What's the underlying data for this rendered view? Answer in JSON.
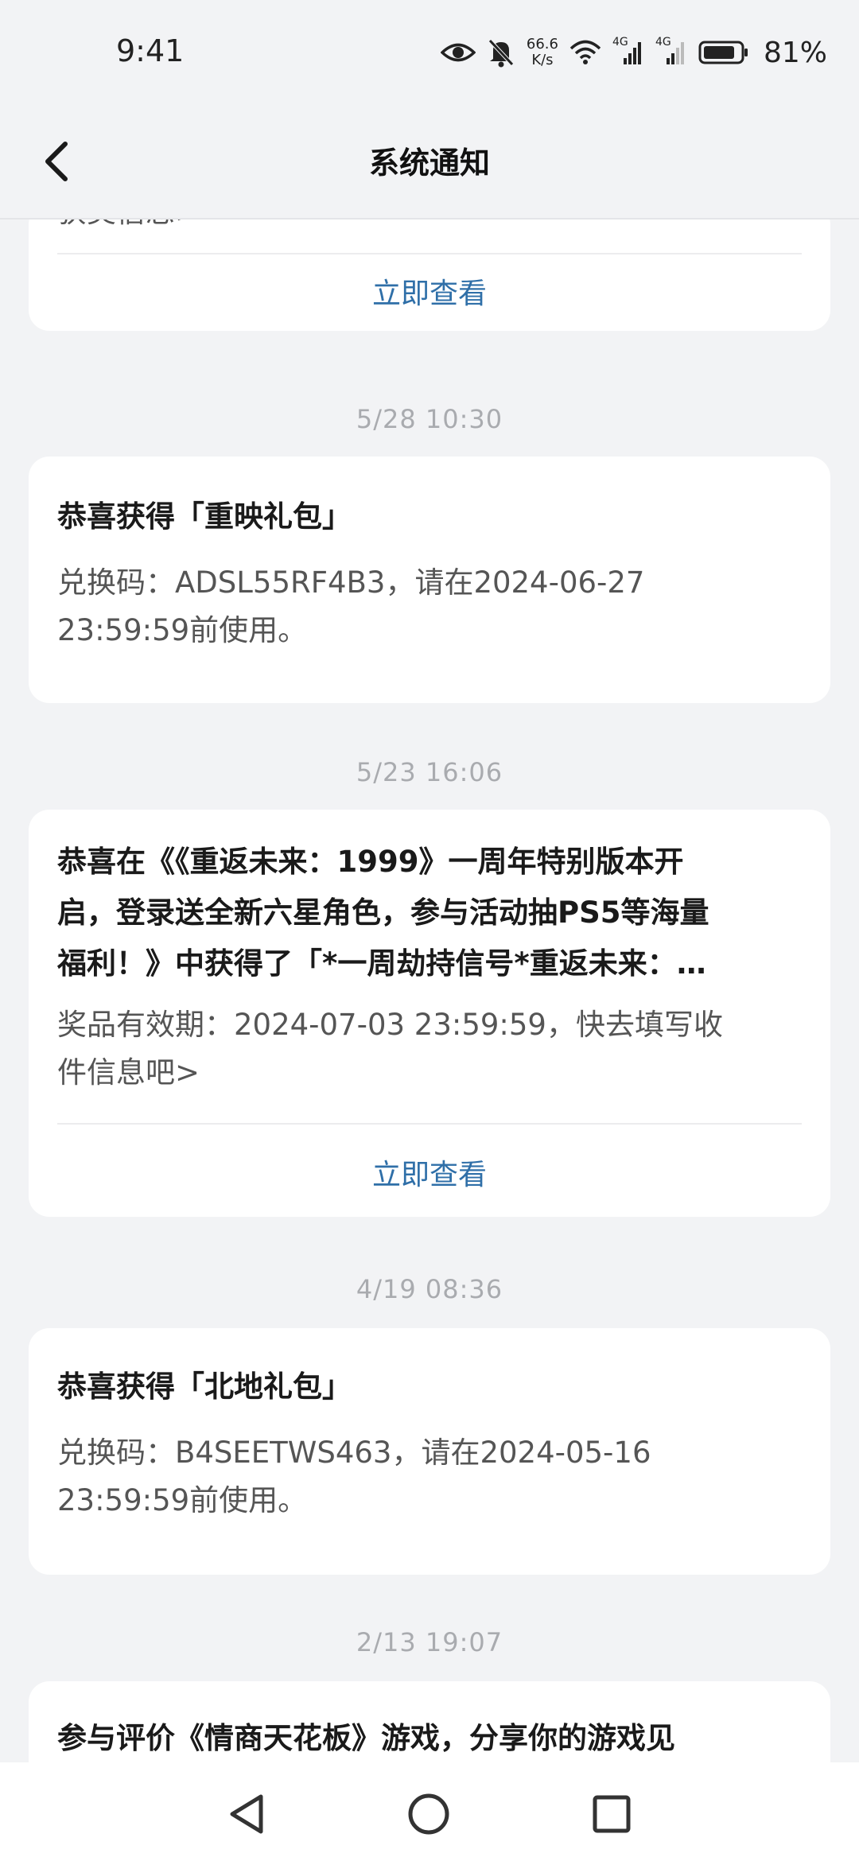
{
  "status_bar": {
    "time": "9:41",
    "net_speed_value": "66.6",
    "net_speed_unit": "K/s",
    "network_1": "4G",
    "network_2": "4G",
    "battery": "81%"
  },
  "header": {
    "title": "系统通知"
  },
  "partial_card": {
    "tail_text": "获奖信息>",
    "action": "立即查看"
  },
  "notifications": [
    {
      "time": "5/28  10:30",
      "title": "恭喜获得「重映礼包」",
      "body_line1": "兑换码：ADSL55RF4B3，请在2024-06-27",
      "body_line2": "23:59:59前使用。"
    },
    {
      "time": "5/23  16:06",
      "title_line1": "恭喜在《《重返未来：1999》一周年特别版本开",
      "title_line2": "启，登录送全新六星角色，参与活动抽PS5等海量",
      "title_line3": "福利！》中获得了「*一周劫持信号*重返未来：…",
      "body_line1": "奖品有效期：2024-07-03 23:59:59，快去填写收",
      "body_line2": "件信息吧>",
      "action": "立即查看"
    },
    {
      "time": "4/19  08:36",
      "title": "恭喜获得「北地礼包」",
      "body_line1": "兑换码：B4SEETWS463，请在2024-05-16",
      "body_line2": "23:59:59前使用。"
    },
    {
      "time": "2/13  19:07",
      "title_line1": "参与评价《情商天花板》游戏，分享你的游戏见"
    }
  ],
  "colors": {
    "background": "#f2f3f5",
    "card": "#ffffff",
    "link": "#2f6fa8",
    "timestamp": "#a9abaf"
  },
  "icons": {
    "back": "chevron-left-icon",
    "eye": "eye-icon",
    "mute": "bell-off-icon",
    "wifi": "wifi-icon",
    "signal": "signal-icon",
    "battery": "battery-icon",
    "nav_back": "triangle-back-icon",
    "nav_home": "circle-home-icon",
    "nav_recent": "square-recent-icon"
  }
}
